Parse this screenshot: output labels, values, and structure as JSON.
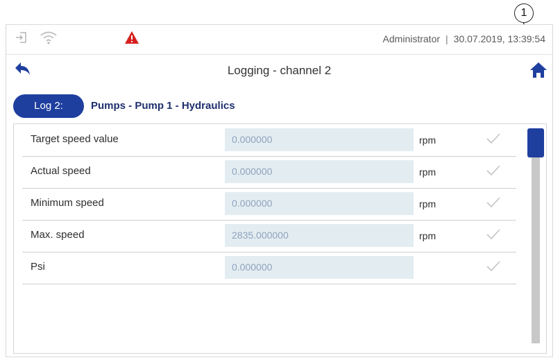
{
  "callout": {
    "number": "1"
  },
  "statusbar": {
    "user": "Administrator",
    "separator": "|",
    "datetime": "30.07.2019, 13:39:54",
    "icons": [
      "login-icon",
      "wifi-icon",
      "warning-triangle-icon"
    ],
    "alarm_color": "#d62020"
  },
  "header": {
    "title": "Logging - channel 2",
    "back_icon": "back-arrow-icon",
    "home_icon": "home-icon"
  },
  "log": {
    "button_label": "Log 2:",
    "path": "Pumps - Pump 1 - Hydraulics",
    "accent_color": "#1f3f9f"
  },
  "rows": [
    {
      "label": "Target speed value",
      "value": "0.000000",
      "unit": "rpm"
    },
    {
      "label": "Actual speed",
      "value": "0.000000",
      "unit": "rpm"
    },
    {
      "label": "Minimum speed",
      "value": "0.000000",
      "unit": "rpm"
    },
    {
      "label": "Max. speed",
      "value": "2835.000000",
      "unit": "rpm"
    },
    {
      "label": "Psi",
      "value": "0.000000",
      "unit": ""
    }
  ]
}
